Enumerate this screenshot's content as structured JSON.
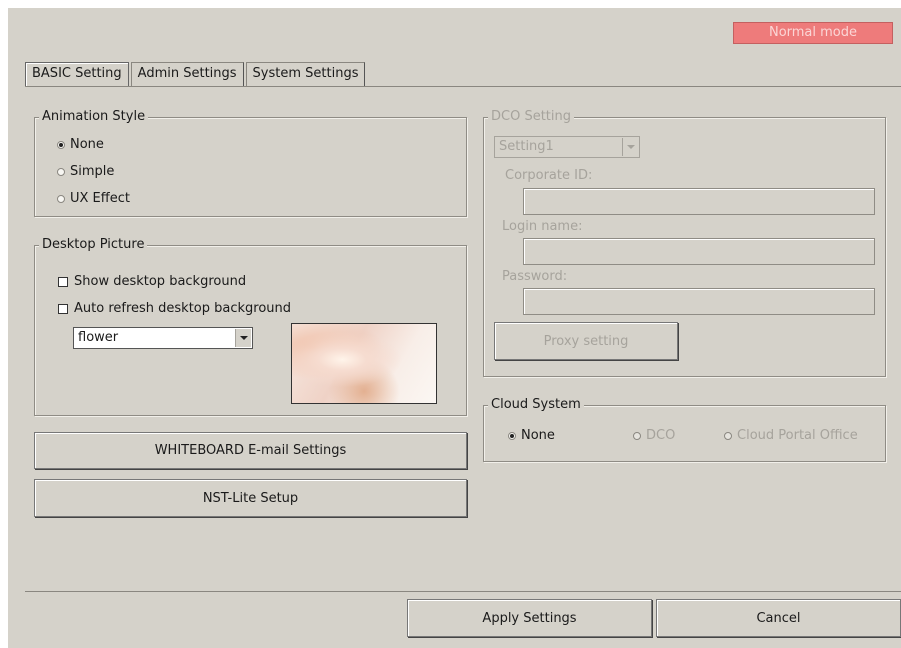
{
  "mode_badge": "Normal mode",
  "tabs": [
    "BASIC Setting",
    "Admin Settings",
    "System Settings"
  ],
  "animation_style": {
    "legend": "Animation Style",
    "options": [
      "None",
      "Simple",
      "UX Effect"
    ],
    "selected": "None"
  },
  "desktop_picture": {
    "legend": "Desktop Picture",
    "show_background": "Show desktop background",
    "auto_refresh": "Auto refresh desktop background",
    "picture_value": "flower"
  },
  "buttons": {
    "whiteboard": "WHITEBOARD E-mail Settings",
    "nst_lite": "NST-Lite Setup",
    "apply": "Apply Settings",
    "cancel": "Cancel"
  },
  "dco_setting": {
    "legend": "DCO Setting",
    "setting_value": "Setting1",
    "corporate_id_label": "Corporate ID:",
    "login_name_label": "Login name:",
    "password_label": "Password:",
    "proxy_button": "Proxy setting"
  },
  "cloud_system": {
    "legend": "Cloud System",
    "options": [
      "None",
      "DCO",
      "Cloud Portal Office"
    ],
    "selected": "None"
  }
}
